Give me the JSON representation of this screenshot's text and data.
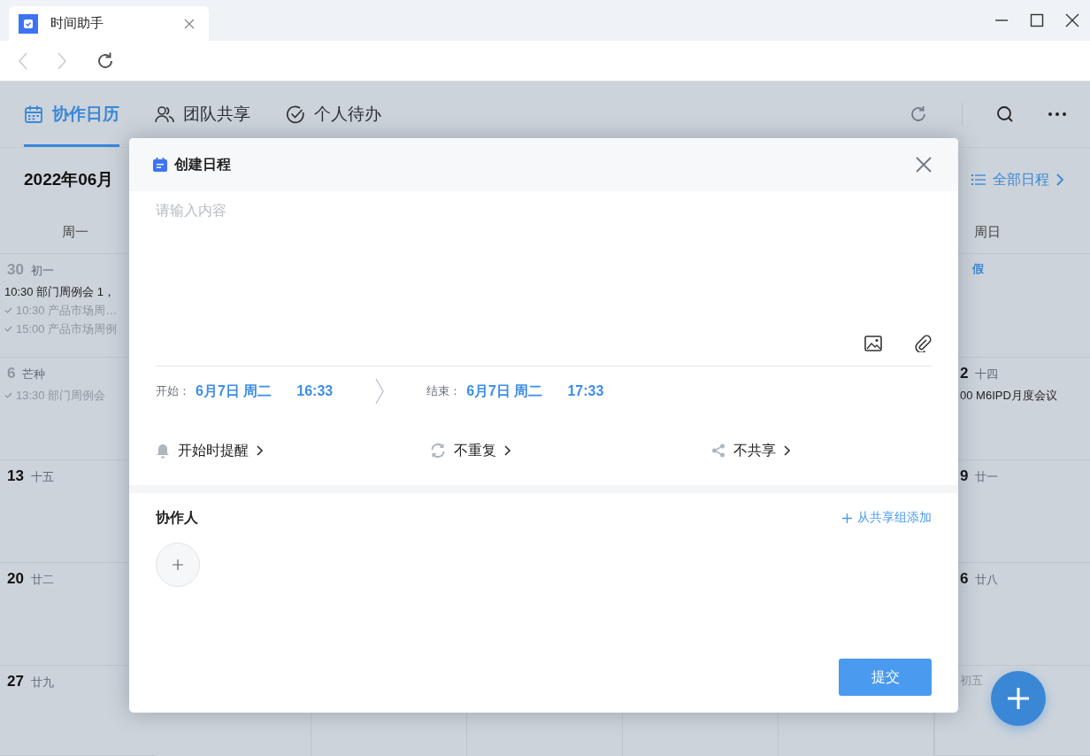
{
  "browser": {
    "tab_title": "时间助手"
  },
  "nav_tabs": [
    {
      "kind": "calendar",
      "label": "协作日历",
      "selected": true
    },
    {
      "kind": "team",
      "label": "团队共享",
      "selected": false
    },
    {
      "kind": "todo",
      "label": "个人待办",
      "selected": false
    }
  ],
  "header": {
    "month": "2022年06月",
    "all_schedules": "全部日程"
  },
  "weekdays": {
    "monday": "周一",
    "sunday": "周日"
  },
  "weeks": [
    {
      "monday": {
        "day": "30",
        "lunar": "初一",
        "muted": true,
        "events": [
          {
            "text": "10:30 部门周例会 1，",
            "done": false
          },
          {
            "text": "10:30 产品市场周…",
            "done": true
          },
          {
            "text": "15:00 产品市场周例",
            "done": true
          }
        ]
      },
      "sunday": {
        "badge": "假"
      }
    },
    {
      "monday": {
        "day": "6",
        "lunar": "芒种",
        "muted": true,
        "events": [
          {
            "text": "13:30 部门周例会",
            "done": true
          }
        ]
      },
      "sunday": {
        "day": "2",
        "lunar": "十四",
        "muted": false,
        "events": [
          {
            "text": "00 M6IPD月度会议",
            "done": false
          }
        ]
      }
    },
    {
      "monday": {
        "day": "13",
        "lunar": "十五",
        "muted": false
      },
      "sunday": {
        "day": "9",
        "lunar": "廿一",
        "muted": false
      }
    },
    {
      "monday": {
        "day": "20",
        "lunar": "廿二",
        "muted": false
      },
      "sunday": {
        "day": "6",
        "lunar": "廿八",
        "muted": false
      }
    },
    {
      "monday": {
        "day": "27",
        "lunar": "廿九",
        "muted": false
      },
      "sunday": {
        "lunar": "初五",
        "muted": true
      }
    }
  ],
  "dialog": {
    "title": "创建日程",
    "placeholder": "请输入内容",
    "start": {
      "label": "开始：",
      "date": "6月7日 周二",
      "time": "16:33"
    },
    "end": {
      "label": "结束：",
      "date": "6月7日 周二",
      "time": "17:33"
    },
    "options": [
      {
        "kind": "reminder",
        "label": "开始时提醒"
      },
      {
        "kind": "repeat",
        "label": "不重复"
      },
      {
        "kind": "share",
        "label": "不共享"
      }
    ],
    "collaborators": {
      "title": "协作人",
      "add_link": "从共享组添加"
    },
    "submit": "提交"
  }
}
